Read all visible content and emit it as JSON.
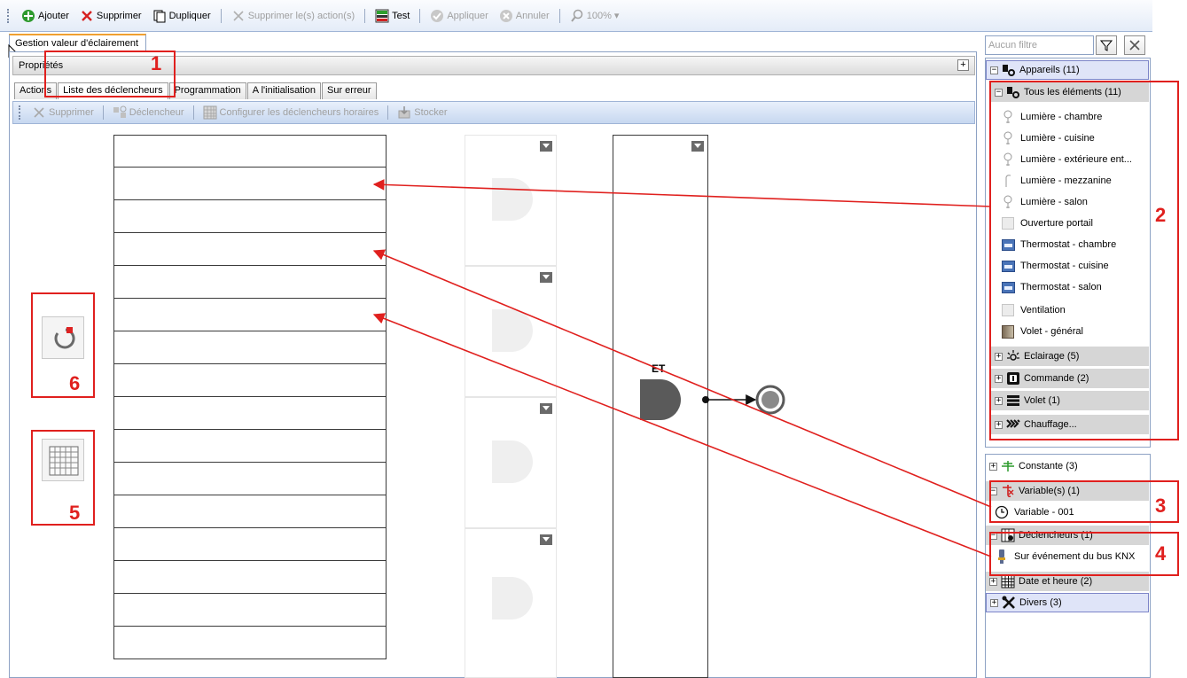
{
  "toolbar": {
    "add_label": "Ajouter",
    "delete_label": "Supprimer",
    "duplicate_label": "Dupliquer",
    "delete_actions_label": "Supprimer le(s) action(s)",
    "test_label": "Test",
    "apply_label": "Appliquer",
    "cancel_label": "Annuler",
    "zoom_label": "100%"
  },
  "document_tab": "Gestion valeur d'éclairement",
  "properties_label": "Propriétés",
  "subtabs": [
    "Actions",
    "Liste des déclencheurs",
    "Programmation",
    "A l'initialisation",
    "Sur erreur"
  ],
  "subtoolbar": {
    "delete_label": "Supprimer",
    "trigger_label": "Déclencheur",
    "configure_label": "Configurer les déclencheurs horaires",
    "store_label": "Stocker"
  },
  "workspace": {
    "gate_label": "ET"
  },
  "filter": {
    "placeholder": "Aucun filtre"
  },
  "tree": {
    "appareils": "Appareils (11)",
    "tous": "Tous les éléments (11)",
    "items": [
      {
        "label": "Lumière - chambre",
        "icon": "bulb-icon"
      },
      {
        "label": "Lumière - cuisine",
        "icon": "bulb-icon"
      },
      {
        "label": "Lumière - extérieure ent...",
        "icon": "bulb-icon"
      },
      {
        "label": "Lumière - mezzanine",
        "icon": "lamp-icon"
      },
      {
        "label": "Lumière - salon",
        "icon": "bulb-icon"
      },
      {
        "label": "Ouverture portail",
        "icon": "gate-icon"
      },
      {
        "label": "Thermostat - chambre",
        "icon": "thermostat-icon"
      },
      {
        "label": "Thermostat - cuisine",
        "icon": "thermostat-icon"
      },
      {
        "label": "Thermostat - salon",
        "icon": "thermostat-icon"
      },
      {
        "label": "Ventilation",
        "icon": "fan-icon"
      },
      {
        "label": "Volet - général",
        "icon": "shutter-icon"
      }
    ],
    "eclairage": "Eclairage (5)",
    "commande": "Commande (2)",
    "volet": "Volet (1)",
    "chauffage": "Chauffage...",
    "constante": "Constante (3)",
    "variables": "Variable(s) (1)",
    "variable_item": "Variable - 001",
    "declencheurs": "Déclencheurs (1)",
    "declencheur_item": "Sur événement du bus KNX",
    "date_heure": "Date et heure (2)",
    "divers": "Divers (3)"
  },
  "annotations": [
    "1",
    "2",
    "3",
    "4",
    "5",
    "6"
  ],
  "colors": {
    "annotation": "#e0201e",
    "toolbar_bg": "#e4ecf8",
    "tree_header_blue": "#dfe4f8",
    "tree_header_gray": "#d6d6d6"
  }
}
